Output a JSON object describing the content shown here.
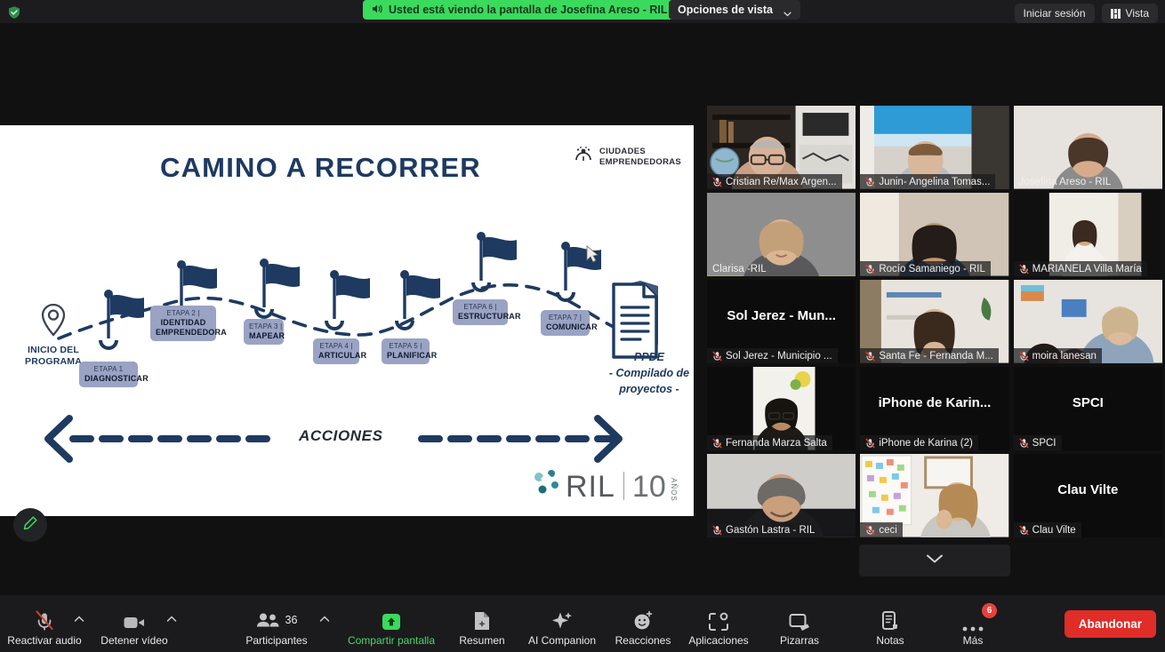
{
  "topbar": {
    "shield_icon": "shield-check-icon",
    "sharing_notice": "Usted está viendo la pantalla de Josefina Areso - RIL",
    "sharing_speaker_icon": "speaker-icon",
    "view_options_label": "Opciones de vista",
    "view_options_caret": "chevron-down-icon",
    "sign_in_label": "Iniciar sesión",
    "view_label": "Vista",
    "view_icon": "grid-layout-icon"
  },
  "shared_screen": {
    "title": "CAMINO A RECORRER",
    "brand": {
      "line1": "CIUDADES",
      "line2": "EMPRENDEDORAS",
      "icon": "ciudades-emprendedoras-icon"
    },
    "start_marker": {
      "icon": "map-pin-icon",
      "line1": "INICIO DEL",
      "line2": "PROGRAMA"
    },
    "stages": [
      {
        "n": "ETAPA 1",
        "v": "DIAGNOSTICAR"
      },
      {
        "n": "ETAPA 2 |",
        "v": "IDENTIDAD EMPRENDEDORA"
      },
      {
        "n": "ETAPA 3 |",
        "v": "MAPEAR"
      },
      {
        "n": "ETAPA 4 |",
        "v": "ARTICULAR"
      },
      {
        "n": "ETAPA 5 |",
        "v": "PLANIFICAR"
      },
      {
        "n": "ETAPA 6 |",
        "v": "ESTRUCTURAR"
      },
      {
        "n": "ETAPA 7 |",
        "v": "COMUNICAR"
      }
    ],
    "ppde": {
      "icon": "documents-icon",
      "line1": "PPDE",
      "line2": "- Compilado de",
      "line3": "proyectos -"
    },
    "actions_label": "ACCIONES",
    "ril_logo": {
      "word": "RIL",
      "years_number": "10",
      "years_label": "AÑOS"
    },
    "annotate_icon": "pencil-icon",
    "slide_accent": "#1e3a61",
    "chip_color": "#9aa3c4"
  },
  "participants_grid": {
    "scroll_down_icon": "chevron-down-icon",
    "tiles": [
      {
        "name": "Cristian Re/Max Argen...",
        "muted": true,
        "video": true,
        "speaking": false,
        "style": "office"
      },
      {
        "name": "Junin- Angelina Tomas...",
        "muted": true,
        "video": true,
        "speaking": false,
        "style": "skyblue"
      },
      {
        "name": "Josefina Areso - RIL",
        "muted": false,
        "video": true,
        "speaking": false,
        "style": "plain"
      },
      {
        "name": "Clarisa -RIL",
        "muted": false,
        "video": true,
        "speaking": true,
        "style": "gray"
      },
      {
        "name": "Rocío Samaniego - RIL",
        "muted": true,
        "video": true,
        "speaking": false,
        "style": "warm"
      },
      {
        "name": "MARIANELA Villa María",
        "muted": true,
        "video": true,
        "speaking": false,
        "style": "hall"
      },
      {
        "name": "Sol Jerez - Municipio ...",
        "big_name": "Sol Jerez - Mun...",
        "muted": true,
        "video": false,
        "speaking": false,
        "style": "none"
      },
      {
        "name": "Santa Fe - Fernanda M...",
        "muted": true,
        "video": true,
        "speaking": false,
        "style": "shelf"
      },
      {
        "name": "moira lanesan",
        "muted": true,
        "video": true,
        "speaking": false,
        "style": "room"
      },
      {
        "name": "Fernanda Marza Salta",
        "muted": true,
        "video": true,
        "speaking": false,
        "style": "portrait"
      },
      {
        "name": "iPhone de Karina (2)",
        "big_name": "iPhone de Karin...",
        "muted": true,
        "video": false,
        "speaking": false,
        "style": "none"
      },
      {
        "name": "SPCI",
        "big_name": "SPCI",
        "muted": true,
        "video": false,
        "speaking": false,
        "style": "none"
      },
      {
        "name": "Gastón Lastra - RIL",
        "muted": true,
        "video": true,
        "speaking": false,
        "style": "man"
      },
      {
        "name": "ceci",
        "muted": true,
        "video": true,
        "speaking": false,
        "style": "board"
      },
      {
        "name": "Clau Vilte",
        "big_name": "Clau Vilte",
        "muted": true,
        "video": false,
        "speaking": false,
        "style": "none"
      }
    ]
  },
  "toolbar": {
    "items": [
      {
        "label": "Reactivar audio",
        "icon": "microphone-muted-icon",
        "caret": true,
        "green": false
      },
      {
        "label": "Detener vídeo",
        "icon": "camera-icon",
        "caret": true,
        "green": false
      },
      {
        "label": "Participantes",
        "icon": "participants-icon",
        "caret": true,
        "green": false,
        "count": "36"
      },
      {
        "label": "Compartir pantalla",
        "icon": "share-screen-icon",
        "caret": false,
        "green": true
      },
      {
        "label": "Resumen",
        "icon": "summary-doc-icon",
        "caret": false,
        "green": false
      },
      {
        "label": "AI Companion",
        "icon": "sparkle-icon",
        "caret": false,
        "green": false
      },
      {
        "label": "Reacciones",
        "icon": "smiley-reaction-icon",
        "caret": false,
        "green": false
      },
      {
        "label": "Aplicaciones",
        "icon": "apps-icon",
        "caret": false,
        "green": false
      },
      {
        "label": "Pizarras",
        "icon": "whiteboard-icon",
        "caret": false,
        "green": false
      },
      {
        "label": "Notas",
        "icon": "notes-icon",
        "caret": false,
        "green": false
      },
      {
        "label": "Más",
        "icon": "more-dots-icon",
        "caret": false,
        "green": false,
        "badge": "6"
      }
    ],
    "leave_label": "Abandonar",
    "leave_color": "#e02d28",
    "accent_green": "#4ad86a"
  }
}
